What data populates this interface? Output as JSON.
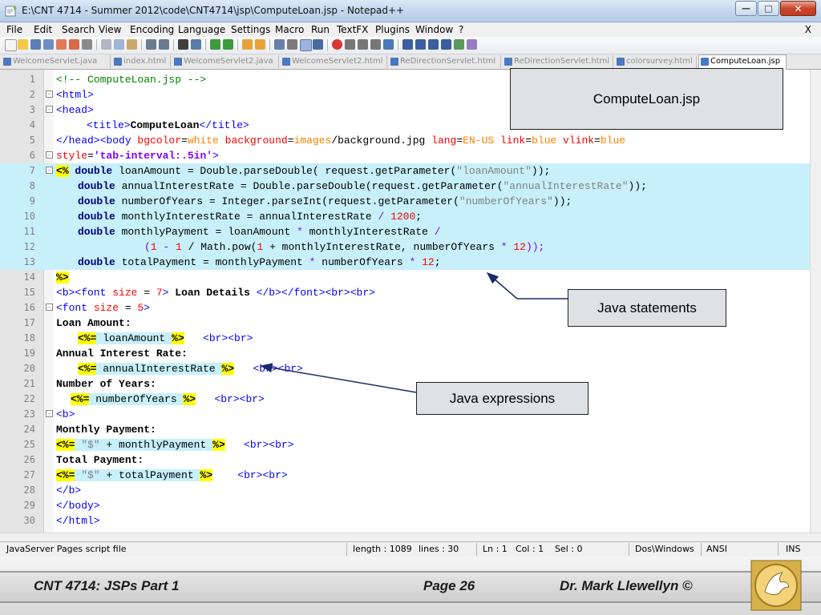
{
  "window": {
    "title": "E:\\CNT 4714 - Summer 2012\\code\\CNT4714\\jsp\\ComputeLoan.jsp - Notepad++",
    "min_glyph": "—",
    "max_glyph": "□",
    "close_glyph": "✕"
  },
  "menu": {
    "items": [
      "File",
      "Edit",
      "Search",
      "View",
      "Encoding",
      "Language",
      "Settings",
      "Macro",
      "Run",
      "TextFX",
      "Plugins",
      "Window",
      "?"
    ],
    "close_glyph": "X"
  },
  "tabs": [
    {
      "label": "WelcomeServlet.java",
      "active": false
    },
    {
      "label": "index.html",
      "active": false
    },
    {
      "label": "WelcomeServlet2.java",
      "active": false
    },
    {
      "label": "WelcomeServlet2.html",
      "active": false
    },
    {
      "label": "ReDirectionServlet.html",
      "active": false
    },
    {
      "label": "ReDirectionServlet.html",
      "active": false
    },
    {
      "label": "colorsurvey.html",
      "active": false
    },
    {
      "label": "ComputeLoan.jsp",
      "active": true
    }
  ],
  "code_lines": [
    "1",
    "2",
    "3",
    "4",
    "5",
    "6",
    "7",
    "8",
    "9",
    "10",
    "11",
    "12",
    "13",
    "14",
    "15",
    "16",
    "17",
    "18",
    "19",
    "20",
    "21",
    "22",
    "23",
    "24",
    "25",
    "26",
    "27",
    "28",
    "29",
    "30"
  ],
  "code": {
    "l1": "<!-- ComputeLoan.jsp -->",
    "l2": "<html>",
    "l3": "<head>",
    "l4a": "<title>",
    "l4b": "ComputeLoan",
    "l4c": "</title>",
    "l5a": "</head><body ",
    "l5b": "bgcolor",
    "l5c": "=",
    "l5d": "white",
    "l5e": " background",
    "l5f": "=",
    "l5g": "images",
    "l5h": "/background.jpg ",
    "l5i": "lang",
    "l5j": "=",
    "l5k": "EN-US",
    "l5l": " link",
    "l5m": "=",
    "l5n": "blue",
    "l5o": " vlink",
    "l5p": "=",
    "l5q": "blue",
    "l6a": "style",
    "l6b": "=",
    "l6c": "'tab-interval:.5in'",
    "l6d": ">",
    "l7a": "<%",
    "l7b": " double",
    "l7c": " loanAmount = Double.parseDouble( request.getParameter(",
    "l7d": "\"loanAmount\"",
    "l7e": "));",
    "l8a": "double",
    "l8b": " annualInterestRate = Double.parseDouble(request.getParameter(",
    "l8c": "\"annualInterestRate\"",
    "l8d": "));",
    "l9a": "double",
    "l9b": " numberOfYears = Integer.parseInt(request.getParameter(",
    "l9c": "\"numberOfYears\"",
    "l9d": "));",
    "l10a": "double",
    "l10b": " monthlyInterestRate = annualInterestRate ",
    "l10c": "/",
    "l10d": " 1200",
    "l10e": ";",
    "l11a": "double",
    "l11b": " monthlyPayment = loanAmount ",
    "l11c": "*",
    "l11d": " monthlyInterestRate ",
    "l11e": "/",
    "l12a": "(",
    "l12b": "1",
    "l12c": " - ",
    "l12d": "1",
    "l12e": " / Math.pow(",
    "l12f": "1",
    "l12g": " + monthlyInterestRate, numberOfYears ",
    "l12h": "*",
    "l12i": " 12",
    "l12j": "));",
    "l13a": "double",
    "l13b": " totalPayment = monthlyPayment ",
    "l13c": "*",
    "l13d": " numberOfYears ",
    "l13e": "*",
    "l13f": " 12",
    "l13g": ";",
    "l14": "%>",
    "l15a": "<b><font ",
    "l15b": "size",
    "l15c": " = ",
    "l15d": "7",
    "l15e": "> ",
    "l15f": "Loan Details",
    "l15g": " </b></font><br><br>",
    "l16a": "<font ",
    "l16b": "size",
    "l16c": " = ",
    "l16d": "5",
    "l16e": ">",
    "l17": "Loan Amount:",
    "l18a": "<%=",
    "l18b": " loanAmount ",
    "l18c": "%>",
    "l18d": "   <br><br>",
    "l19": "Annual Interest Rate:",
    "l20a": "<%=",
    "l20b": " annualInterestRate ",
    "l20c": "%>",
    "l20d": "   <br><br>",
    "l21": "Number of Years:",
    "l22a": "<%=",
    "l22b": " numberOfYears ",
    "l22c": "%>",
    "l22d": "   <br><br>",
    "l23": "<b>",
    "l24": "Monthly Payment:",
    "l25a": "<%=",
    "l25b": " \"$\"",
    "l25c": " + monthlyPayment ",
    "l25d": "%>",
    "l25e": "   <br><br>",
    "l26": "Total Payment:",
    "l27a": "<%=",
    "l27b": " \"$\"",
    "l27c": " + totalPayment ",
    "l27d": "%>",
    "l27e": "    <br><br>",
    "l28": "</b>",
    "l29": "</body>",
    "l30": "</html>"
  },
  "callouts": {
    "file": "ComputeLoan.jsp",
    "statements": "Java statements",
    "expressions": "Java expressions"
  },
  "status": {
    "filetype": "JavaServer Pages script file",
    "length": "length : 1089",
    "lines": "lines : 30",
    "ln": "Ln : 1",
    "col": "Col : 1",
    "sel": "Sel : 0",
    "eol": "Dos\\Windows",
    "encoding": "ANSI",
    "mode": "INS"
  },
  "footer": {
    "course": "CNT 4714:  JSPs Part 1",
    "page": "Page 26",
    "author": "Dr. Mark Llewellyn ©"
  },
  "colors": {
    "java_block": "#c7f0fb",
    "jsp_delim": "#ffff00",
    "keyword": "#000080",
    "tag": "#0000ff",
    "attr": "#ff0000"
  }
}
